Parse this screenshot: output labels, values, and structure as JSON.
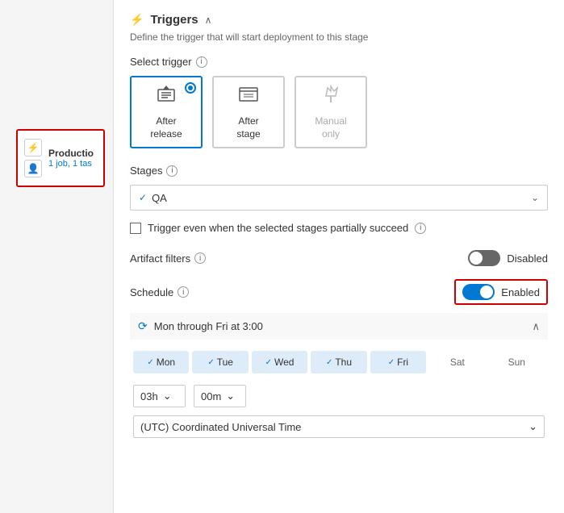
{
  "sidebar": {
    "stage_title": "Productio",
    "stage_subtitle": "1 job, 1 tas"
  },
  "panel": {
    "header_icon": "⚡",
    "title": "Triggers",
    "subtitle": "Define the trigger that will start deployment to this stage",
    "select_trigger_label": "Select trigger",
    "trigger_options": [
      {
        "id": "after-release",
        "label": "After\nrelease",
        "selected": true,
        "disabled": false,
        "icon": "📥"
      },
      {
        "id": "after-stage",
        "label": "After\nstage",
        "selected": false,
        "disabled": false,
        "icon": "☰"
      },
      {
        "id": "manual-only",
        "label": "Manual\nonly",
        "selected": false,
        "disabled": true,
        "icon": "⚡"
      }
    ],
    "stages_label": "Stages",
    "stages_value": "QA",
    "checkbox_label": "Trigger even when the selected stages partially succeed",
    "artifact_filters_label": "Artifact filters",
    "artifact_filters_toggle": "Disabled",
    "artifact_filters_enabled": false,
    "schedule_label": "Schedule",
    "schedule_toggle": "Enabled",
    "schedule_enabled": true,
    "schedule_summary": "Mon through Fri at 3:00",
    "days": [
      {
        "label": "Mon",
        "active": true
      },
      {
        "label": "Tue",
        "active": true
      },
      {
        "label": "Wed",
        "active": true
      },
      {
        "label": "Thu",
        "active": true
      },
      {
        "label": "Fri",
        "active": true
      },
      {
        "label": "Sat",
        "active": false
      },
      {
        "label": "Sun",
        "active": false
      }
    ],
    "hour_value": "03h",
    "minute_value": "00m",
    "timezone_value": "(UTC) Coordinated Universal Time"
  }
}
